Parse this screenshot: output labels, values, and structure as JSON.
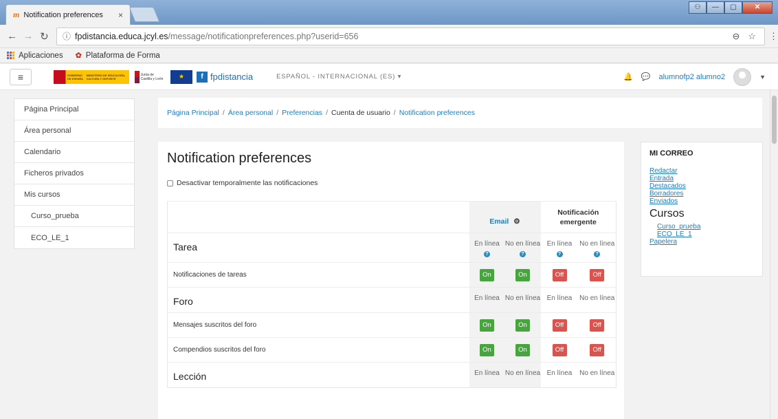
{
  "browser": {
    "tab_title": "Notification preferences",
    "tab_close": "×",
    "url_host": "fpdistancia.educa.jcyl.es",
    "url_path": "/message/notificationpreferences.php?userid=656",
    "bookmarks": [
      "Aplicaciones",
      "Plataforma de Forma"
    ]
  },
  "navbar": {
    "brand": "fpdistancia",
    "language": "ESPAÑOL - INTERNACIONAL (ES) ▾",
    "user": "alumnofp2 alumno2",
    "logo_gob_text": "GOBIERNO DE ESPAÑA",
    "logo_ministry_text": "MINISTERIO DE EDUCACIÓN, CULTURA Y DEPORTE",
    "logo_jcyl_text": "Junta de Castilla y León"
  },
  "sidebar": {
    "items": [
      {
        "label": "Página Principal"
      },
      {
        "label": "Área personal"
      },
      {
        "label": "Calendario"
      },
      {
        "label": "Ficheros privados"
      },
      {
        "label": "Mis cursos"
      },
      {
        "label": "Curso_prueba"
      },
      {
        "label": "ECO_LE_1"
      }
    ]
  },
  "breadcrumb": {
    "items": [
      "Página Principal",
      "Área personal",
      "Preferencias",
      "Cuenta de usuario",
      "Notification preferences"
    ],
    "separator": "/"
  },
  "main": {
    "title": "Notification preferences",
    "disable_label": "Desactivar temporalmente las notificaciones",
    "header_email": "Email",
    "header_popup": "Notificación emergente",
    "online": "En línea",
    "offline": "No en línea",
    "on": "On",
    "off": "Off",
    "help": "?",
    "sections": [
      {
        "title": "Tarea",
        "rows": [
          "Notificaciones de tareas"
        ]
      },
      {
        "title": "Foro",
        "rows": [
          "Mensajes suscritos del foro",
          "Compendios suscritos del foro"
        ]
      },
      {
        "title": "Lección",
        "rows": []
      }
    ]
  },
  "mail_block": {
    "title": "MI CORREO",
    "links": [
      "Redactar",
      "Entrada",
      "Destacados",
      "Borradores",
      "Enviados"
    ],
    "cursos_heading": "Cursos",
    "courses": [
      "Curso_prueba",
      "ECO_LE_1"
    ],
    "trash": "Papelera"
  }
}
